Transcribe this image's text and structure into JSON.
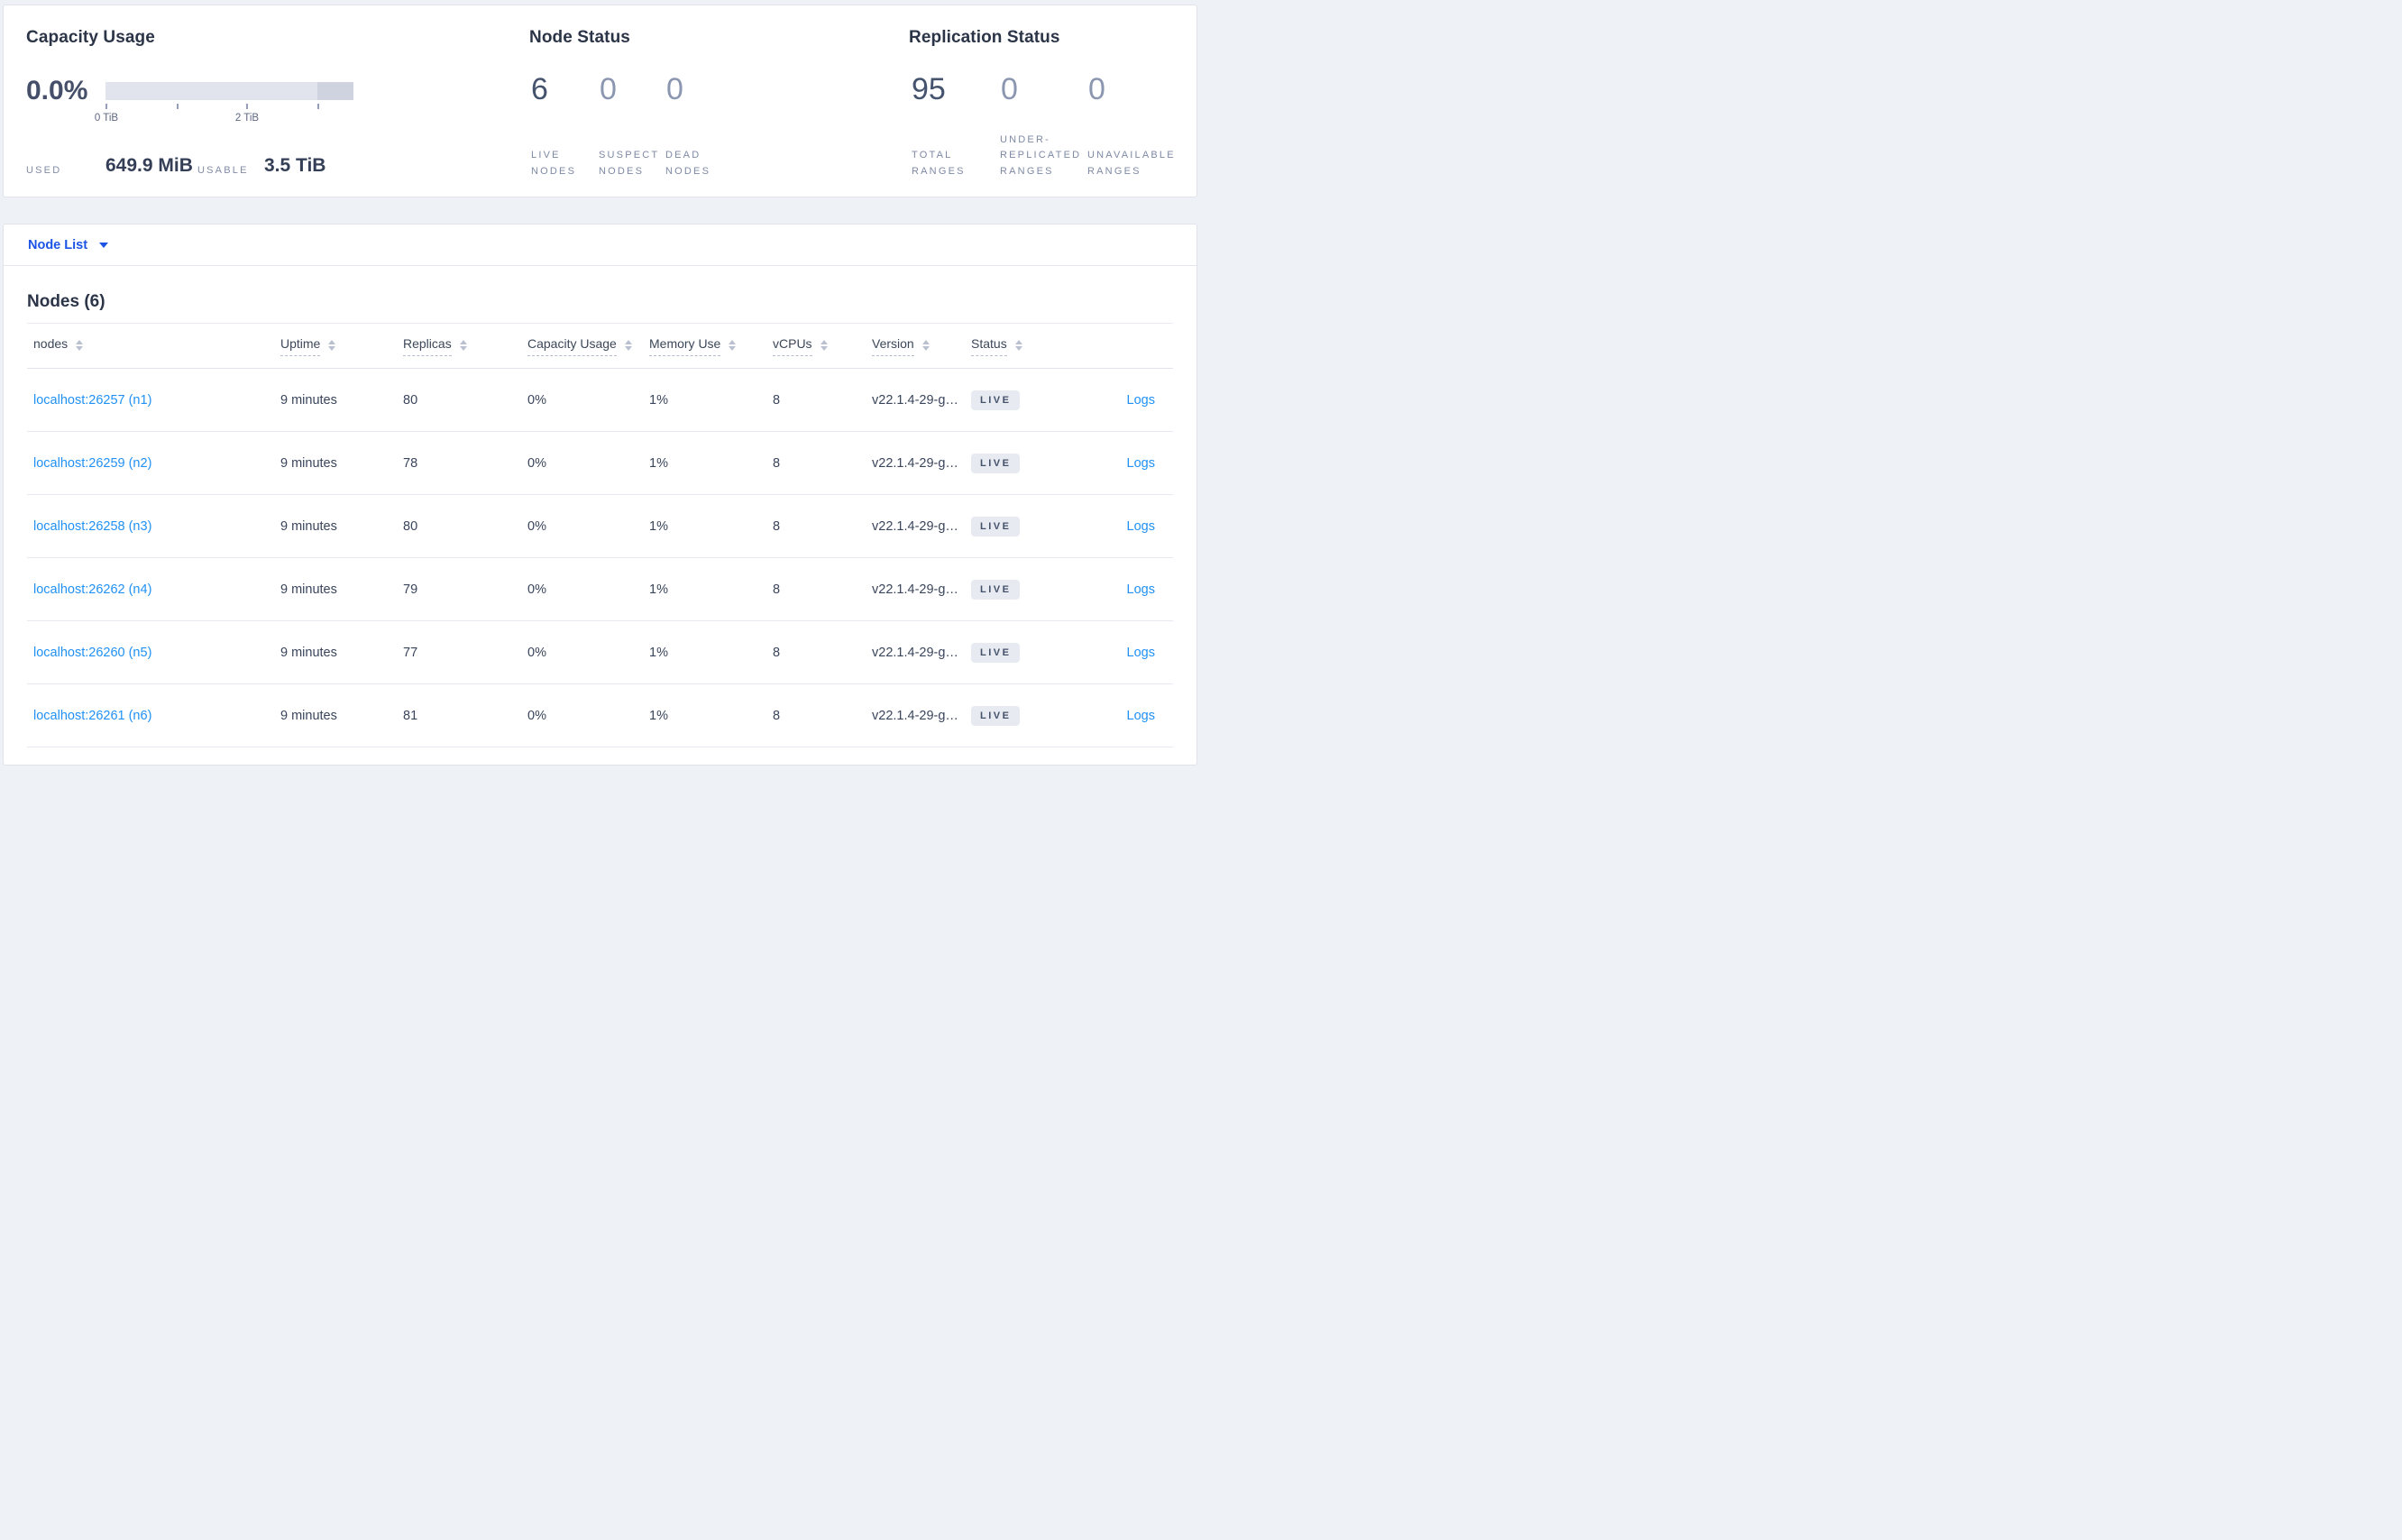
{
  "summary": {
    "capacity": {
      "title": "Capacity Usage",
      "percent": "0.0%",
      "tick_label_0": "0 TiB",
      "tick_label_2": "2 TiB",
      "used_label": "USED",
      "used_value": "649.9 MiB",
      "usable_label": "USABLE",
      "usable_value": "3.5 TiB"
    },
    "node_status": {
      "title": "Node Status",
      "stats": [
        {
          "value": "6",
          "label": "LIVE\nNODES"
        },
        {
          "value": "0",
          "label": "SUSPECT\nNODES"
        },
        {
          "value": "0",
          "label": "DEAD\nNODES"
        }
      ]
    },
    "replication": {
      "title": "Replication Status",
      "stats": [
        {
          "value": "95",
          "label": "TOTAL\nRANGES"
        },
        {
          "value": "0",
          "label": "UNDER-\nREPLICATED\nRANGES"
        },
        {
          "value": "0",
          "label": "UNAVAILABLE\nRANGES"
        }
      ]
    }
  },
  "subnav": {
    "dropdown_label": "Node List"
  },
  "table": {
    "title": "Nodes (6)",
    "columns": [
      {
        "label": "nodes"
      },
      {
        "label": "Uptime"
      },
      {
        "label": "Replicas"
      },
      {
        "label": "Capacity Usage"
      },
      {
        "label": "Memory Use"
      },
      {
        "label": "vCPUs"
      },
      {
        "label": "Version"
      },
      {
        "label": "Status"
      }
    ],
    "rows": [
      {
        "node": "localhost:26257 (n1)",
        "uptime": "9 minutes",
        "replicas": "80",
        "capacity": "0%",
        "memory": "1%",
        "vcpus": "8",
        "version": "v22.1.4-29-g…",
        "status": "LIVE",
        "logs": "Logs"
      },
      {
        "node": "localhost:26259 (n2)",
        "uptime": "9 minutes",
        "replicas": "78",
        "capacity": "0%",
        "memory": "1%",
        "vcpus": "8",
        "version": "v22.1.4-29-g…",
        "status": "LIVE",
        "logs": "Logs"
      },
      {
        "node": "localhost:26258 (n3)",
        "uptime": "9 minutes",
        "replicas": "80",
        "capacity": "0%",
        "memory": "1%",
        "vcpus": "8",
        "version": "v22.1.4-29-g…",
        "status": "LIVE",
        "logs": "Logs"
      },
      {
        "node": "localhost:26262 (n4)",
        "uptime": "9 minutes",
        "replicas": "79",
        "capacity": "0%",
        "memory": "1%",
        "vcpus": "8",
        "version": "v22.1.4-29-g…",
        "status": "LIVE",
        "logs": "Logs"
      },
      {
        "node": "localhost:26260 (n5)",
        "uptime": "9 minutes",
        "replicas": "77",
        "capacity": "0%",
        "memory": "1%",
        "vcpus": "8",
        "version": "v22.1.4-29-g…",
        "status": "LIVE",
        "logs": "Logs"
      },
      {
        "node": "localhost:26261 (n6)",
        "uptime": "9 minutes",
        "replicas": "81",
        "capacity": "0%",
        "memory": "1%",
        "vcpus": "8",
        "version": "v22.1.4-29-g…",
        "status": "LIVE",
        "logs": "Logs"
      }
    ]
  },
  "colors": {
    "page_bg": "#eef1f6",
    "card_border": "#e0e4ea",
    "title_text": "#2b3547",
    "stat_emphasis": "#46536e",
    "stat_dim": "#8b96b0",
    "small_label": "#7e89a4",
    "bar_light": "#e2e4ed",
    "bar_dark": "#ced3df",
    "subnav_link_blue": "#1c54e6",
    "row_link_blue": "#2191f3",
    "badge_bg": "#e7eaf0",
    "badge_text": "#44516b"
  }
}
